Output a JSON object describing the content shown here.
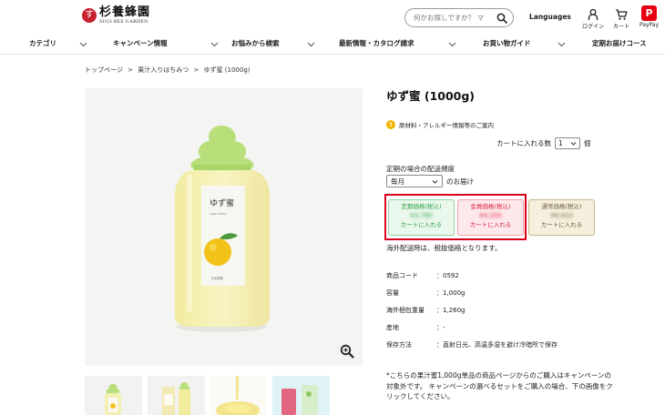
{
  "header": {
    "logo_mark": "す",
    "logo_jp": "杉養蜂園",
    "logo_en": "SUGI BEE GARDEN",
    "search_placeholder": "何かお探しですか？ マ",
    "languages": "Languages",
    "login": "ログイン",
    "cart": "カート",
    "paypay_mark": "P",
    "paypay": "PayPay"
  },
  "nav": {
    "items": [
      "カテゴリ",
      "キャンペーン情報",
      "お悩みから検索",
      "最新情報・カタログ請求",
      "お買い物ガイド",
      "定期お届けコース"
    ]
  },
  "breadcrumb": [
    "トップページ",
    ">",
    "果汁入りはちみつ",
    ">",
    "ゆず蜜 (1000g)"
  ],
  "product": {
    "title": "ゆず蜜 (1000g)",
    "info_link": "原材料・アレルギー情報等のご案内",
    "qty_label": "カートに入れる数",
    "qty_value": "1",
    "qty_unit": "個",
    "freq_label": "定期の場合の配送頻度",
    "freq_value": "毎月",
    "freq_suffix": "のお届け",
    "prices": [
      {
        "label": "定期価格(税込)",
        "amount": "¥3,780",
        "cta": "カートに入れる"
      },
      {
        "label": "会員価格(税込)",
        "amount": "¥4,200",
        "cta": "カートに入れる"
      },
      {
        "label": "通常価格(税込)",
        "amount": "¥4,410",
        "cta": "カートに入れる"
      }
    ],
    "notice": "海外配送時は、税抜価格となります。",
    "specs": [
      {
        "key": "商品コード",
        "value": "：0592"
      },
      {
        "key": "容量",
        "value": "：1,000g"
      },
      {
        "key": "海外梱包重量",
        "value": "：1,260g"
      },
      {
        "key": "産地",
        "value": "：-"
      },
      {
        "key": "保存方法",
        "value": "：直射日光、高温多湿を避け冷暗所で保存"
      }
    ],
    "note": "*こちらの果汁蜜1,000g単品の商品ページからのご購入はキャンペーンの対象外です。 キャンペーンの選べるセットをご購入の場合、下の画像をクリックしてください。",
    "bottle_label_title": "ゆず蜜",
    "bottle_label_sub": "YUZU MITSU",
    "bottle_label_brand": "杉養蜂園"
  },
  "colors": {
    "brand_red": "#c8202f",
    "highlight_red": "#d9001b",
    "subscription_green": "#2ea54a",
    "member_red": "#d92540",
    "regular_tan": "#6b5e3a"
  }
}
